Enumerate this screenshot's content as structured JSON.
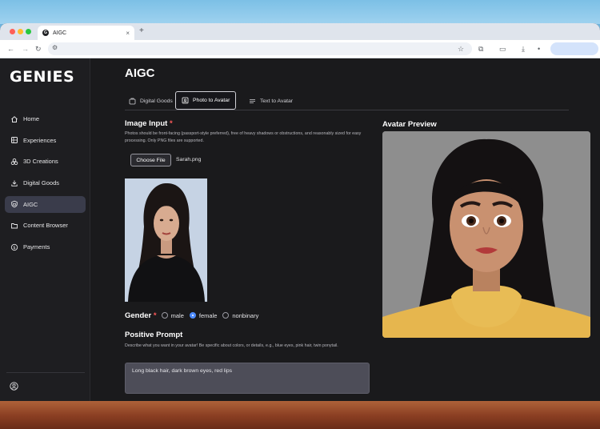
{
  "browser": {
    "tab_title": "AIGC",
    "tab_close": "×",
    "new_tab": "+"
  },
  "sidebar": {
    "logo": "GENIES",
    "items": [
      {
        "label": "Home",
        "icon": "home-icon"
      },
      {
        "label": "Experiences",
        "icon": "experiences-icon"
      },
      {
        "label": "3D Creations",
        "icon": "cubes-icon"
      },
      {
        "label": "Digital Goods",
        "icon": "download-icon"
      },
      {
        "label": "AIGC",
        "icon": "shield-icon",
        "active": true
      },
      {
        "label": "Content Browser",
        "icon": "folder-icon"
      },
      {
        "label": "Payments",
        "icon": "dollar-icon"
      }
    ]
  },
  "main": {
    "title": "AIGC",
    "tabs": [
      {
        "label": "Digital Goods"
      },
      {
        "label": "Photo to Avatar",
        "active": true
      },
      {
        "label": "Text to Avatar"
      }
    ],
    "image_input": {
      "label": "Image Input",
      "required_mark": "*",
      "hint": "Photos should be front-facing (passport-style preferred), free of heavy shadows or obstructions, and reasonably sized for easy processing. Only PNG files are supported.",
      "choose_file_label": "Choose File",
      "file_name": "Sarah.png"
    },
    "gender": {
      "label": "Gender",
      "required_mark": "*",
      "options": [
        "male",
        "female",
        "nonbinary"
      ],
      "selected": "female"
    },
    "positive_prompt": {
      "label": "Positive Prompt",
      "hint": "Describe what you want in your avatar! Be specific about colors, or details, e.g., blue eyes, pink hair, twin ponytail.",
      "value": "Long black hair, dark brown eyes, red lips"
    },
    "preview": {
      "label": "Avatar Preview"
    }
  },
  "colors": {
    "app_background": "#1a1a1c",
    "sidebar_active": "#3a3c4b",
    "required": "#ff5a5a",
    "radio_selected": "#4e8cff",
    "prompt_box": "#4d4d58"
  }
}
